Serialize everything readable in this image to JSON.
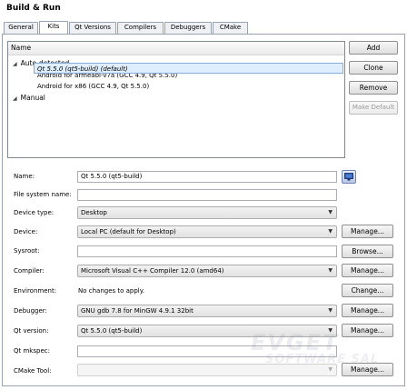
{
  "window": {
    "title": "Build & Run"
  },
  "tabs": [
    {
      "label": "General"
    },
    {
      "label": "Kits"
    },
    {
      "label": "Qt Versions"
    },
    {
      "label": "Compilers"
    },
    {
      "label": "Debuggers"
    },
    {
      "label": "CMake"
    }
  ],
  "tree": {
    "header": "Name",
    "auto_group": "Auto-detected",
    "auto_items": [
      "Android for armeabi-v7a (GCC 4.9, Qt 5.5.0)",
      "Android for x86 (GCC 4.9, Qt 5.5.0)"
    ],
    "manual_group": "Manual",
    "manual_items": [
      "Qt 5.5.0 (qt5-build) (default)"
    ]
  },
  "side_buttons": {
    "add": "Add",
    "clone": "Clone",
    "remove": "Remove",
    "make_default": "Make Default"
  },
  "form": {
    "name_label": "Name:",
    "name_value": "Qt 5.5.0 (qt5-build)",
    "fs_label": "File system name:",
    "fs_value": "",
    "device_type_label": "Device type:",
    "device_type_value": "Desktop",
    "device_label": "Device:",
    "device_value": "Local PC (default for Desktop)",
    "sysroot_label": "Sysroot:",
    "sysroot_value": "",
    "compiler_label": "Compiler:",
    "compiler_value": "Microsoft Visual C++ Compiler 12.0 (amd64)",
    "environment_label": "Environment:",
    "environment_value": "No changes to apply.",
    "debugger_label": "Debugger:",
    "debugger_value": "GNU gdb 7.8 for MinGW 4.9.1 32bit",
    "qt_version_label": "Qt version:",
    "qt_version_value": "Qt 5.5.0 (qt5-build)",
    "qt_mkspec_label": "Qt mkspec:",
    "qt_mkspec_value": "",
    "cmake_label": "CMake Tool:",
    "cmake_value": ""
  },
  "row_buttons": {
    "device_manage": "Manage...",
    "sysroot_browse": "Browse...",
    "compiler_manage": "Manage...",
    "environment_change": "Change...",
    "debugger_manage": "Manage...",
    "qt_version_manage": "Manage...",
    "cmake_manage": "Manage..."
  },
  "watermark": {
    "line1": "EVGET",
    "line2": "SOFTWARE SAL"
  },
  "icons": {
    "kit_icon": "monitor-icon",
    "expand_icon": "triangle-down-icon",
    "combo_arrow": "chevron-down-icon"
  }
}
